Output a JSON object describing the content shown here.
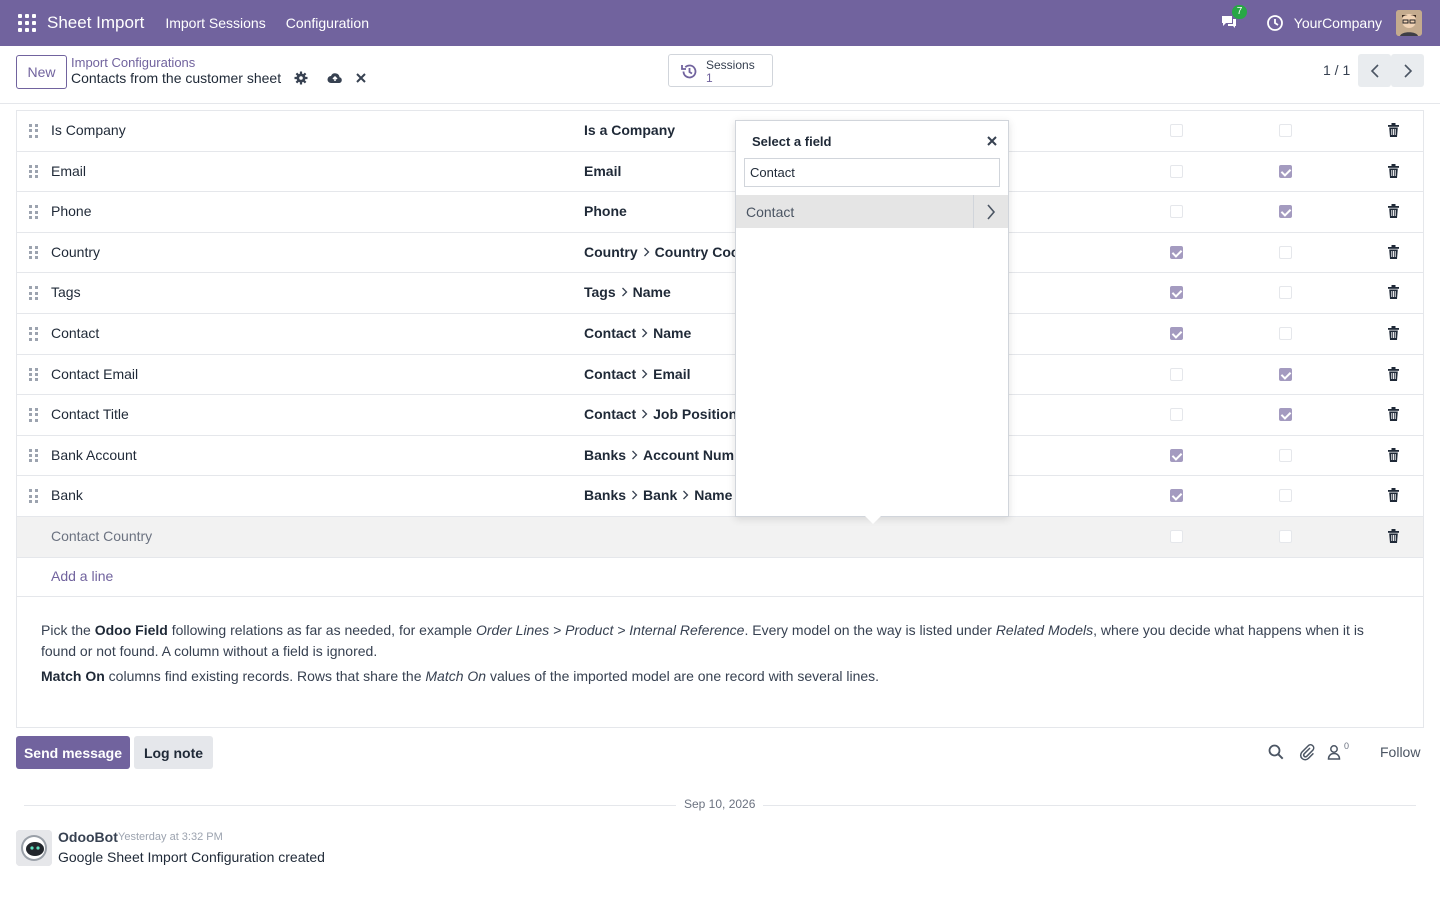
{
  "navbar": {
    "brand": "Sheet Import",
    "menu": [
      "Import Sessions",
      "Configuration"
    ],
    "chat_badge": "7",
    "company": "YourCompany",
    "color": "#71639e"
  },
  "control_panel": {
    "new_label": "New",
    "breadcrumb_parent": "Import Configurations",
    "breadcrumb_current": "Contacts from the customer sheet",
    "sessions_label": "Sessions",
    "sessions_count": "1",
    "pager": "1 / 1"
  },
  "rows": [
    {
      "name": "Is Company",
      "path": [
        "Is a Company"
      ],
      "c1": false,
      "c2": false
    },
    {
      "name": "Email",
      "path": [
        "Email"
      ],
      "c1": false,
      "c2": true
    },
    {
      "name": "Phone",
      "path": [
        "Phone"
      ],
      "c1": false,
      "c2": true
    },
    {
      "name": "Country",
      "path": [
        "Country",
        "Country Coc"
      ],
      "c1": true,
      "c2": false
    },
    {
      "name": "Tags",
      "path": [
        "Tags",
        "Name"
      ],
      "c1": true,
      "c2": false
    },
    {
      "name": "Contact",
      "path": [
        "Contact",
        "Name"
      ],
      "c1": true,
      "c2": false
    },
    {
      "name": "Contact Email",
      "path": [
        "Contact",
        "Email"
      ],
      "c1": false,
      "c2": true
    },
    {
      "name": "Contact Title",
      "path": [
        "Contact",
        "Job Position"
      ],
      "c1": false,
      "c2": true
    },
    {
      "name": "Bank Account",
      "path": [
        "Banks",
        "Account Numb"
      ],
      "c1": true,
      "c2": false
    },
    {
      "name": "Bank",
      "path": [
        "Banks",
        "Bank",
        "Name"
      ],
      "c1": true,
      "c2": false
    },
    {
      "name": "Contact Country",
      "path": [],
      "c1": false,
      "c2": false,
      "muted": true
    }
  ],
  "add_line": "Add a line",
  "help": {
    "p1_a": "Pick the ",
    "p1_b": "Odoo Field",
    "p1_c": " following relations as far as needed, for example ",
    "p1_d": "Order Lines > Product > Internal Reference",
    "p1_e": ". Every model on the way is listed under ",
    "p1_f": "Related Models",
    "p1_g": ", where you decide what happens when it is found or not found. A column without a field is ignored.",
    "p2_a": "Match On",
    "p2_b": " columns find existing records. Rows that share the ",
    "p2_c": "Match On",
    "p2_d": " values of the imported model are one record with several lines."
  },
  "chatter": {
    "send_label": "Send message",
    "log_label": "Log note",
    "followers_count": "0",
    "follow_label": "Follow",
    "date": "Sep 10, 2026",
    "author": "OdooBot",
    "time": "Yesterday at 3:32 PM",
    "body": "Google Sheet Import Configuration created"
  },
  "popover": {
    "title": "Select a field",
    "search_value": "Contact",
    "items": [
      "Contact"
    ]
  }
}
